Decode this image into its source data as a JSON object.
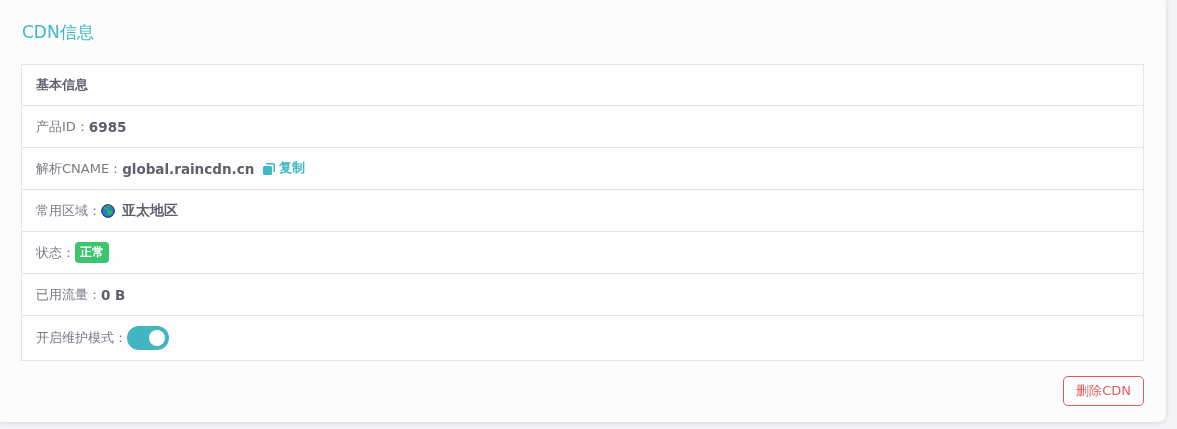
{
  "title": "CDN信息",
  "info": {
    "heading": "基本信息",
    "rows": [
      {
        "kind": "text",
        "label": "产品ID：",
        "value": "6985"
      },
      {
        "kind": "copy",
        "label": "解析CNAME：",
        "value": "global.raincdn.cn",
        "action": "复制"
      },
      {
        "kind": "region",
        "label": "常用区域：",
        "value": "亚太地区"
      },
      {
        "kind": "badge",
        "label": "状态：",
        "value": "正常",
        "color": "#3cc46e"
      },
      {
        "kind": "text",
        "label": "已用流量：",
        "value": "0 B"
      },
      {
        "kind": "toggle",
        "label": "开启维护模式：",
        "on": true
      }
    ]
  },
  "delete_button": "删除CDN"
}
